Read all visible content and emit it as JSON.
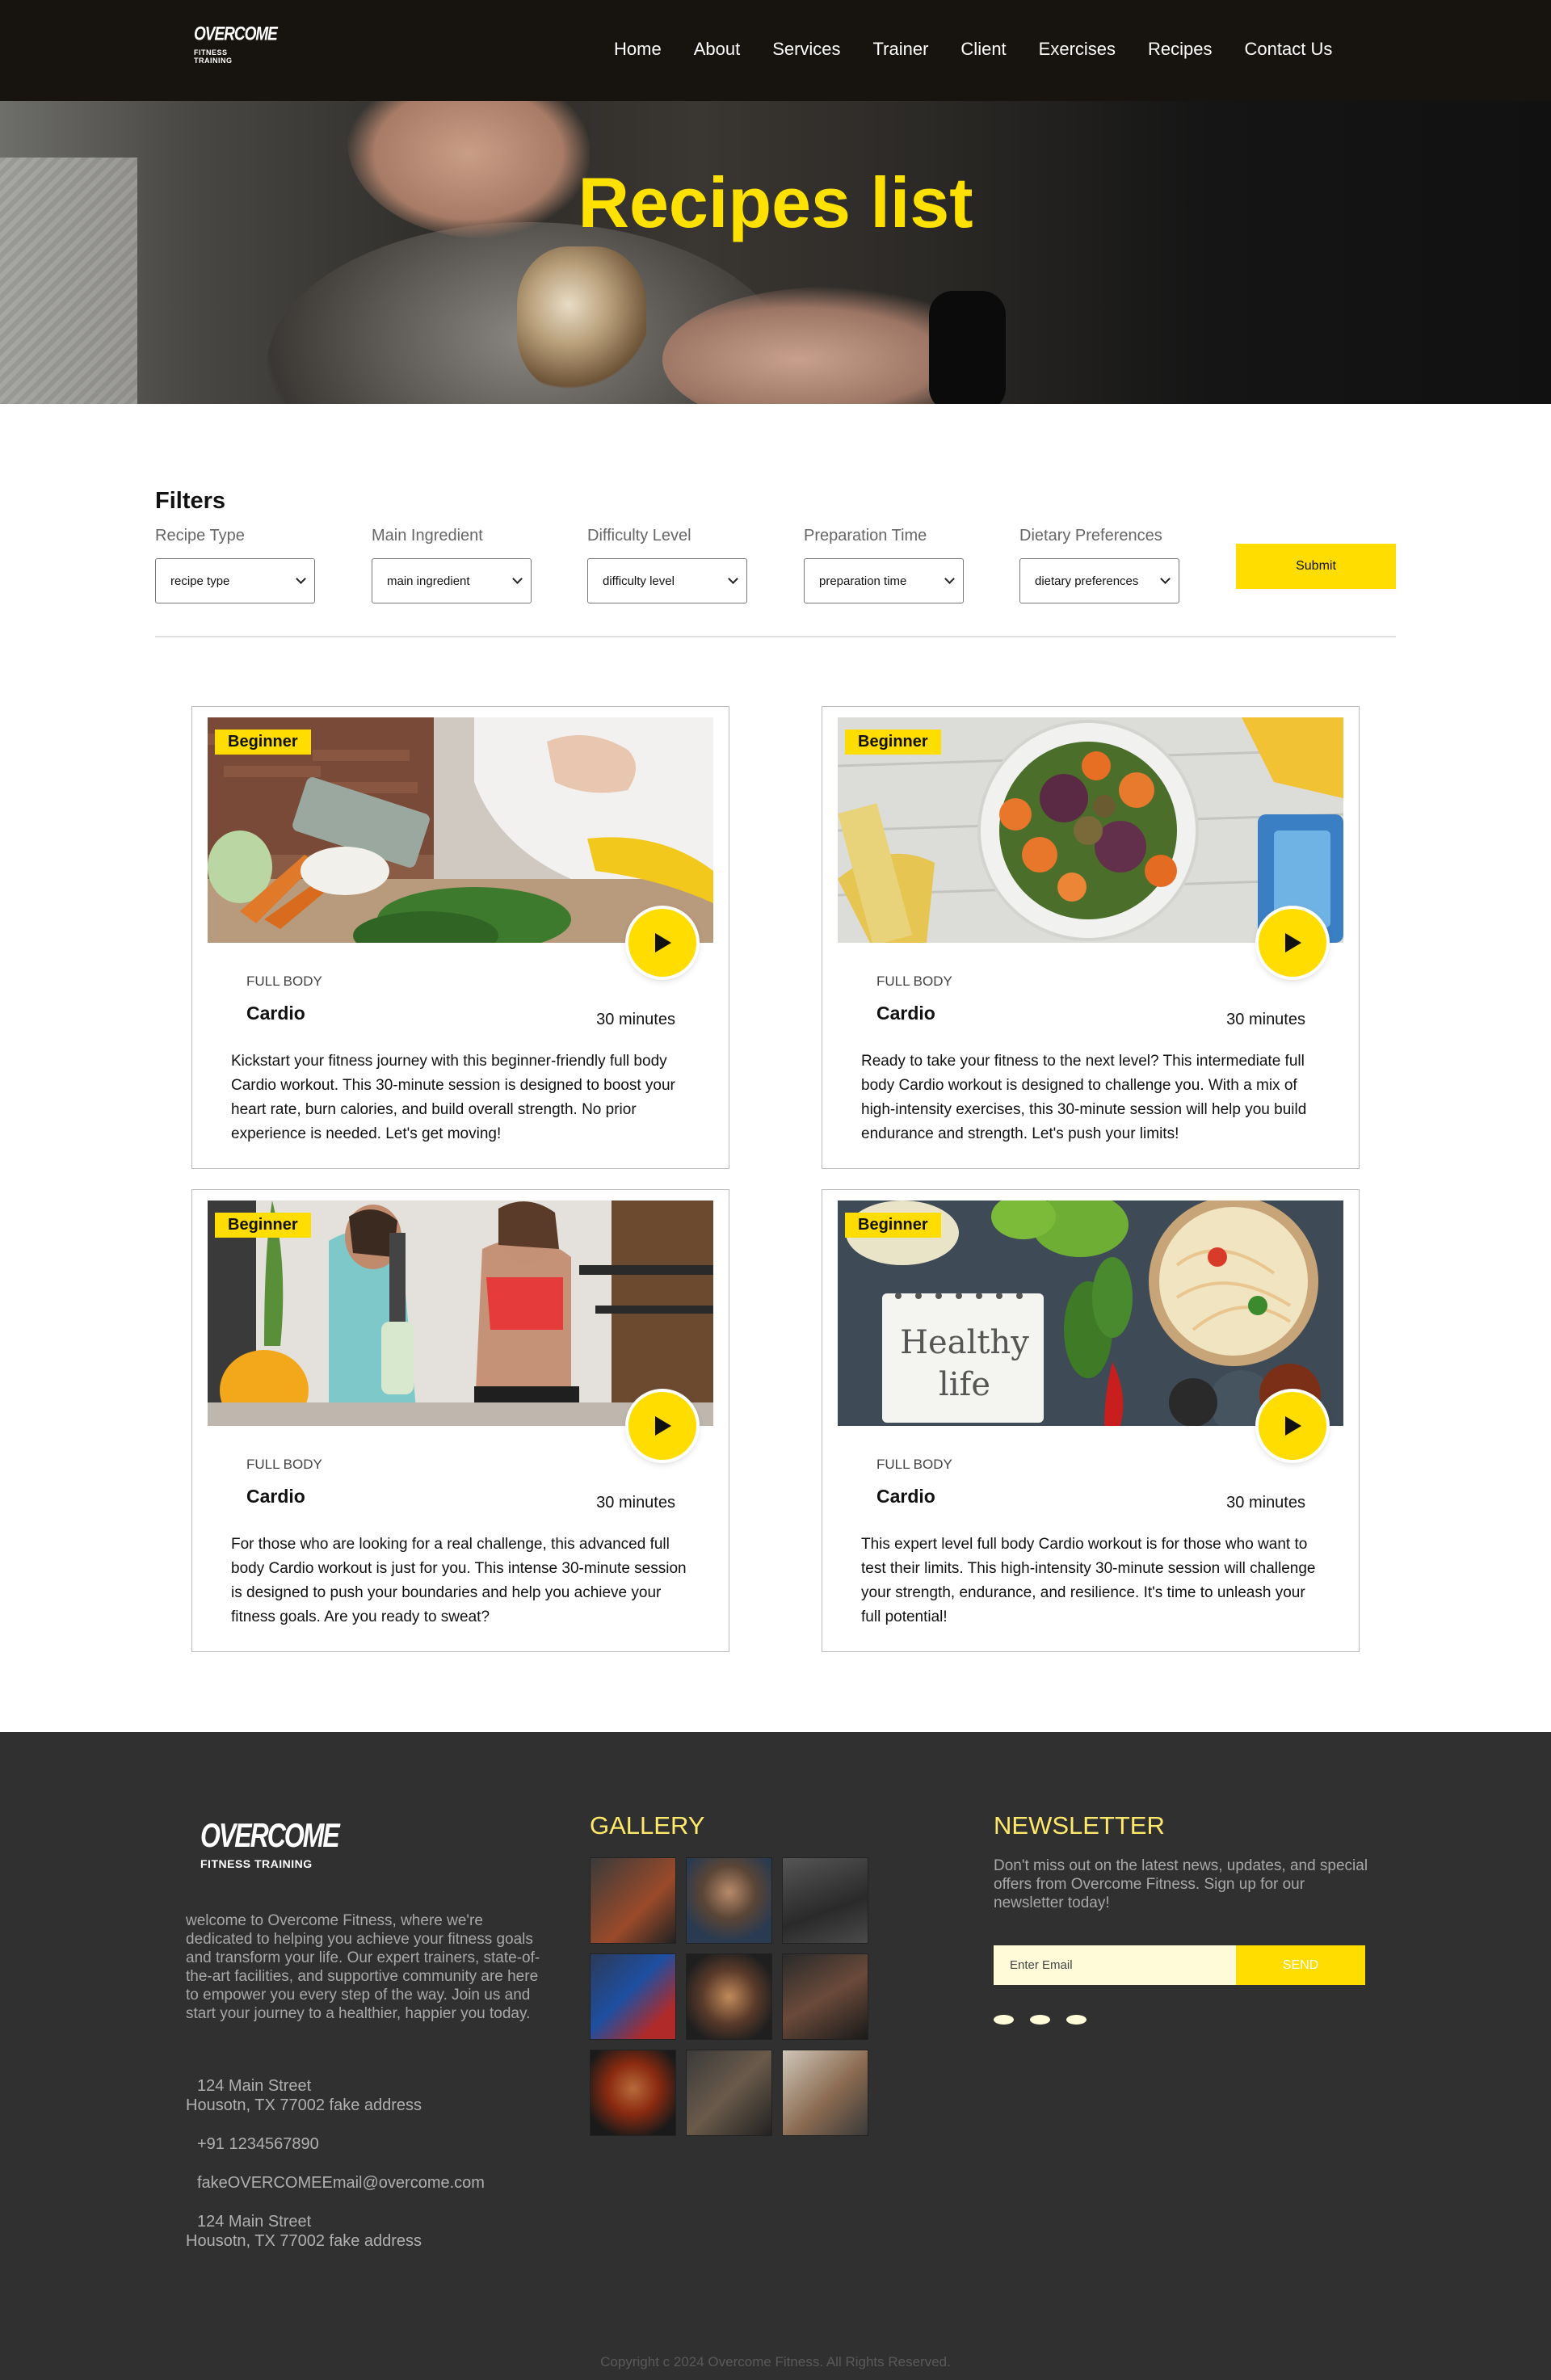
{
  "brand": {
    "logo_line1": "OVERCOME",
    "logo_line2": "FITNESS TRAINING"
  },
  "nav": {
    "items": [
      {
        "label": "Home"
      },
      {
        "label": "About"
      },
      {
        "label": "Services"
      },
      {
        "label": "Trainer"
      },
      {
        "label": "Client"
      },
      {
        "label": "Exercises"
      },
      {
        "label": "Recipes"
      },
      {
        "label": "Contact Us"
      }
    ]
  },
  "hero": {
    "title": "Recipes list"
  },
  "filters": {
    "title": "Filters",
    "groups": [
      {
        "label": "Recipe Type",
        "value": "recipe type"
      },
      {
        "label": "Main Ingredient",
        "value": "main ingredient"
      },
      {
        "label": "Difficulty Level",
        "value": "difficulty level"
      },
      {
        "label": "Preparation Time",
        "value": "preparation time"
      },
      {
        "label": "Dietary Preferences",
        "value": "dietary preferences"
      }
    ],
    "submit_label": "Submit"
  },
  "cards": [
    {
      "badge": "Beginner",
      "category": "FULL BODY",
      "name": "Cardio",
      "time": "30 minutes",
      "description": "Kickstart your fitness journey with this beginner-friendly full body Cardio workout. This 30-minute session is designed to boost your heart rate, burn calories, and build overall strength. No prior experience is needed. Let's get moving!"
    },
    {
      "badge": "Beginner",
      "category": "FULL BODY",
      "name": "Cardio",
      "time": "30 minutes",
      "description": "Ready to take your fitness to the next level? This intermediate full body Cardio workout is designed to challenge you. With a mix of high-intensity exercises, this 30-minute session will help you build endurance and strength. Let's push your limits!"
    },
    {
      "badge": "Beginner",
      "category": "FULL BODY",
      "name": "Cardio",
      "time": "30 minutes",
      "description": "For those who are looking for a real challenge, this advanced full body Cardio workout is just for you. This intense 30-minute session is designed to push your boundaries and help you achieve your fitness goals. Are you ready to sweat?"
    },
    {
      "badge": "Beginner",
      "category": "FULL BODY",
      "name": "Cardio",
      "time": "30 minutes",
      "description": "This expert level full body Cardio workout is for those who want to test their limits. This high-intensity 30-minute session will challenge your strength, endurance, and resilience. It's time to unleash your full potential!",
      "image_text": "Healthy life"
    }
  ],
  "footer": {
    "about": "welcome to Overcome Fitness, where we're dedicated to helping you achieve your fitness goals and transform your life. Our expert trainers, state-of-the-art facilities, and supportive community are here to empower you every step of the way. Join us and start your journey to a healthier, happier you today.",
    "address1_line1": "124 Main Street",
    "address1_line2": "Housotn, TX 77002 fake address",
    "phone": "+91 1234567890",
    "email": "fakeOVERCOMEEmail@overcome.com",
    "address2_line1": "124 Main Street",
    "address2_line2": "Housotn, TX 77002 fake address",
    "gallery_title": "GALLERY",
    "newsletter_title": "NEWSLETTER",
    "newsletter_text": "Don't miss out on the latest news, updates, and special offers from Overcome Fitness. Sign up for our newsletter today!",
    "email_placeholder": "Enter Email",
    "send_label": "SEND",
    "copyright": "Copyright c 2024 Overcome Fitness. All Rights Reserved."
  },
  "colors": {
    "accent": "#ffdd00",
    "nav_bg": "#17140f",
    "footer_bg": "#303030",
    "footer_heading": "#ffe96a"
  }
}
